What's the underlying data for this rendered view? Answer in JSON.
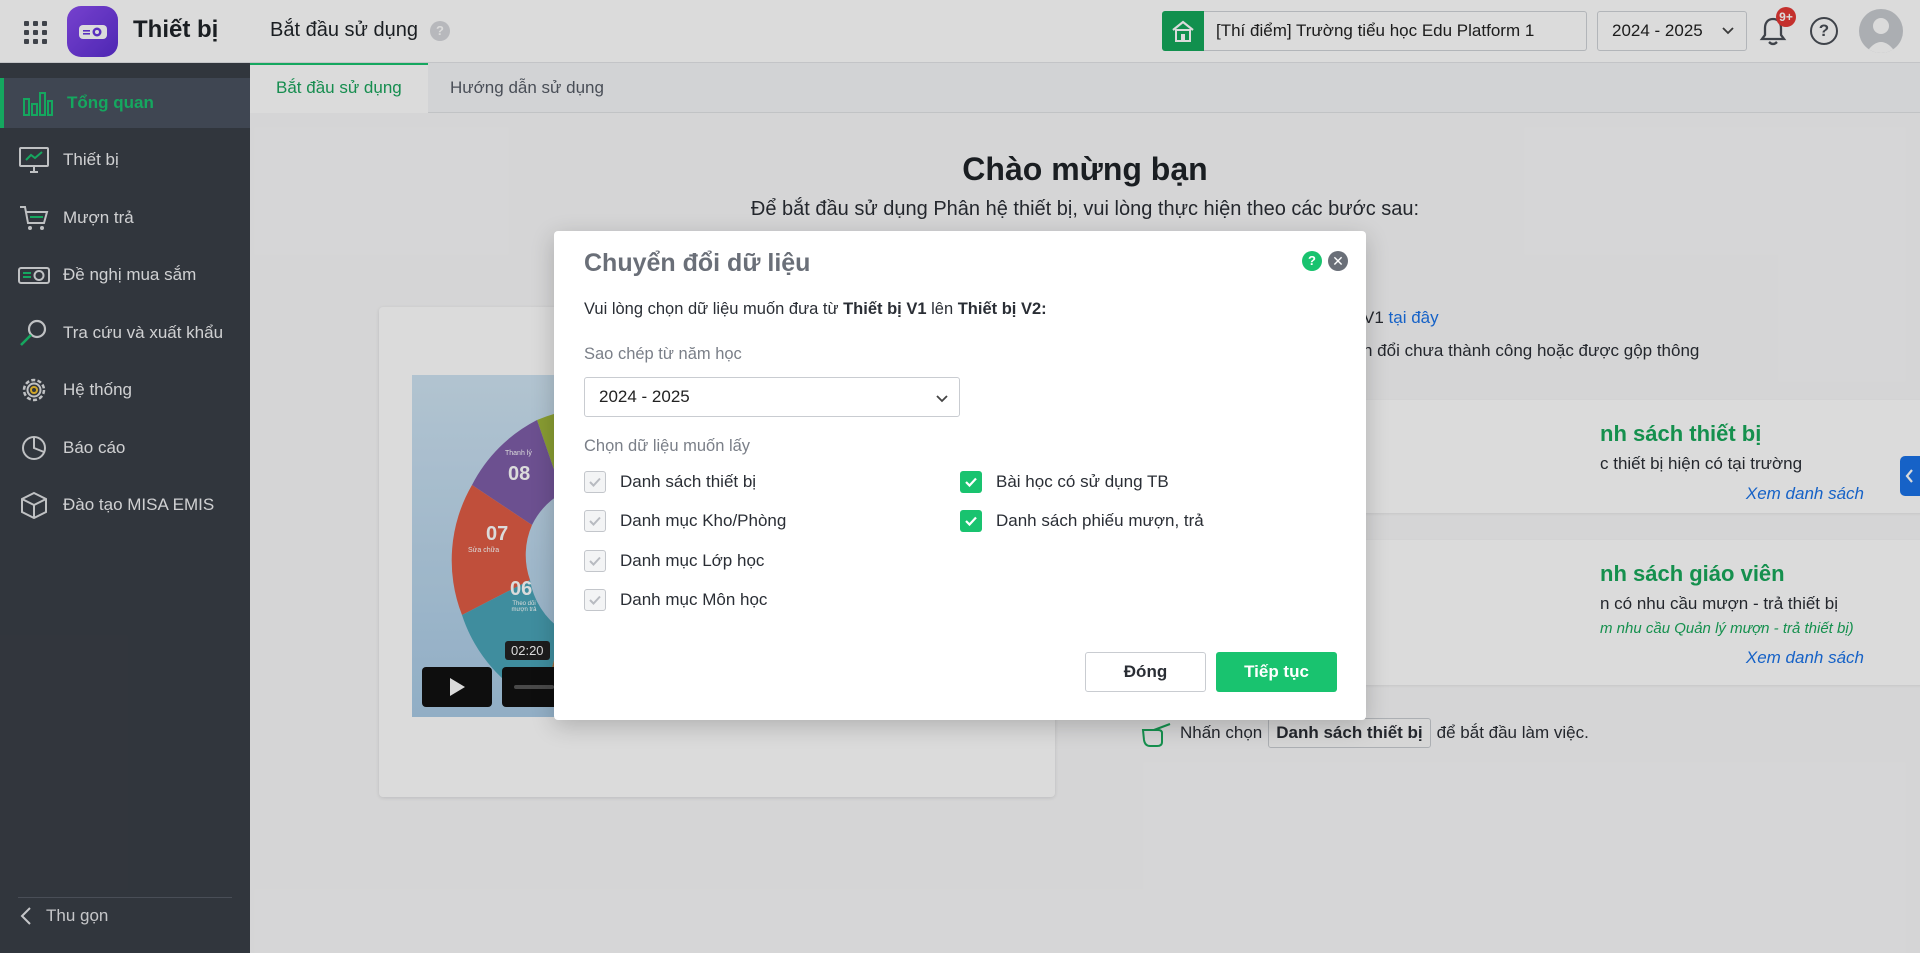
{
  "app": {
    "title": "Thiết bị",
    "page_heading": "Bắt đầu sử dụng",
    "help_glyph": "?"
  },
  "header": {
    "school": "[Thí điểm] Trường tiểu học Edu Platform 1",
    "year": "2024 - 2025",
    "notification_badge": "9+"
  },
  "sidebar": {
    "items": [
      {
        "label": "Tổng quan",
        "icon": "bar-chart-icon",
        "active": true
      },
      {
        "label": "Thiết bị",
        "icon": "monitor-icon"
      },
      {
        "label": "Mượn trả",
        "icon": "cart-icon"
      },
      {
        "label": "Đề nghị mua sắm",
        "icon": "projector-icon"
      },
      {
        "label": "Tra cứu và xuất khẩu",
        "icon": "search-icon"
      },
      {
        "label": "Hệ thống",
        "icon": "gear-icon"
      },
      {
        "label": "Báo cáo",
        "icon": "pie-chart-icon"
      },
      {
        "label": "Đào tạo MISA EMIS",
        "icon": "box-icon"
      }
    ],
    "collapse_label": "Thu gọn"
  },
  "tabs": [
    {
      "label": "Bắt đầu sử dụng",
      "active": true
    },
    {
      "label": "Hướng dẫn sử dụng"
    }
  ],
  "main": {
    "welcome": "Chào mừng bạn",
    "subtitle": "Để bắt đầu sử dụng Phân hệ thiết bị, vui lòng thực hiện theo các bước sau:",
    "partial_text_1": "V1",
    "partial_link": "tại đây",
    "partial_text_2": "n đổi chưa thành công hoặc được gộp thông",
    "video": {
      "timestamp": "02:20",
      "segments": [
        "08",
        "07",
        "06"
      ],
      "segment_captions": [
        "Thanh lý",
        "Sửa chữa",
        "Theo dõi mượn trả"
      ]
    },
    "card1": {
      "title": "nh sách thiết bị",
      "desc": "c thiết bị hiện có tại trường",
      "link": "Xem danh sách"
    },
    "card2": {
      "title": "nh sách giáo viên",
      "desc": "n có nhu cầu mượn - trả thiết bị",
      "note": "m nhu cầu Quản lý mượn - trả thiết bị)",
      "link": "Xem danh sách"
    },
    "hint": {
      "prefix": "Nhấn chọn",
      "button": "Danh sách thiết bị",
      "suffix": "để bắt đầu làm việc."
    }
  },
  "modal": {
    "title": "Chuyển đổi dữ liệu",
    "help_glyph": "?",
    "close_glyph": "✕",
    "intro_prefix": "Vui lòng chọn dữ liệu muốn đưa từ ",
    "intro_from": "Thiết bị V1",
    "intro_mid": " lên ",
    "intro_to": "Thiết bị V2:",
    "copy_from_label": "Sao chép từ năm học",
    "copy_from_value": "2024 - 2025",
    "choose_label": "Chọn dữ liệu muốn lấy",
    "options_left": [
      {
        "label": "Danh sách thiết bị",
        "state": "disabled"
      },
      {
        "label": "Danh mục Kho/Phòng",
        "state": "disabled"
      },
      {
        "label": "Danh mục Lớp học",
        "state": "disabled"
      },
      {
        "label": "Danh mục Môn học",
        "state": "disabled"
      }
    ],
    "options_right": [
      {
        "label": "Bài học có sử dụng TB",
        "state": "checked"
      },
      {
        "label": "Danh sách phiếu mượn, trả",
        "state": "checked"
      }
    ],
    "btn_close": "Đóng",
    "btn_next": "Tiếp tục"
  },
  "colors": {
    "accent": "#19c36f",
    "sidebar_bg": "#3a3f47",
    "link": "#1a73e8",
    "brand": "#6b37e0"
  }
}
